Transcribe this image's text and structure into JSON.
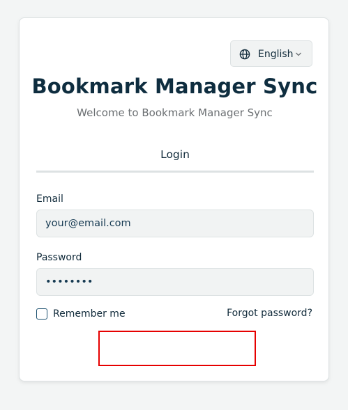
{
  "language_selector": {
    "label": "English",
    "icon": "globe-icon",
    "chevron_icon": "chevron-down-icon"
  },
  "header": {
    "title": "Bookmark Manager Sync",
    "subtitle": "Welcome to Bookmark Manager Sync"
  },
  "tabs": [
    {
      "label": "Login",
      "active": true
    }
  ],
  "form": {
    "email": {
      "label": "Email",
      "placeholder": "your@email.com",
      "value": ""
    },
    "password": {
      "label": "Password",
      "value": "••••••••"
    },
    "remember": {
      "label": "Remember me",
      "checked": false
    },
    "forgot_label": "Forgot password?"
  },
  "colors": {
    "title": "#0e2d3f",
    "highlight": "#e60000",
    "field_bg": "#f1f3f3"
  }
}
